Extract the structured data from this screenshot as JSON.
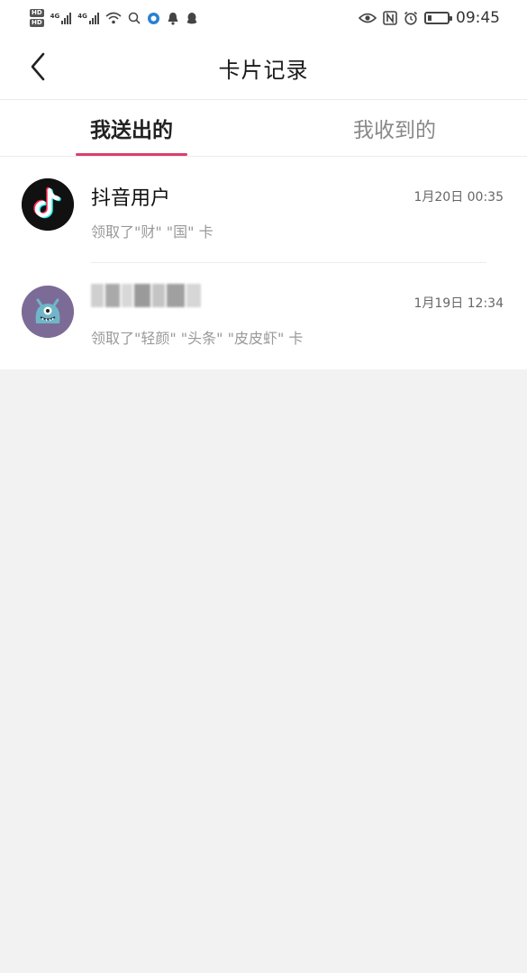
{
  "status_bar": {
    "time": "09:45",
    "network_tag": "4G",
    "sim_chips": [
      "HD",
      "HD"
    ]
  },
  "nav": {
    "title": "卡片记录"
  },
  "tabs": [
    {
      "label": "我送出的",
      "active": true
    },
    {
      "label": "我收到的",
      "active": false
    }
  ],
  "records": [
    {
      "name": "抖音用户",
      "time": "1月20日 00:35",
      "description": "领取了\"财\" \"国\" 卡",
      "avatar_icon": "douyin-logo-icon"
    },
    {
      "name": "",
      "time": "1月19日 12:34",
      "description": "领取了\"轻颜\" \"头条\" \"皮皮虾\" 卡",
      "avatar_icon": "monster-avatar-icon"
    }
  ],
  "colors": {
    "accent": "#d9406d",
    "page_bg": "#f2f2f2",
    "avatar2_bg": "#7d6b97"
  }
}
